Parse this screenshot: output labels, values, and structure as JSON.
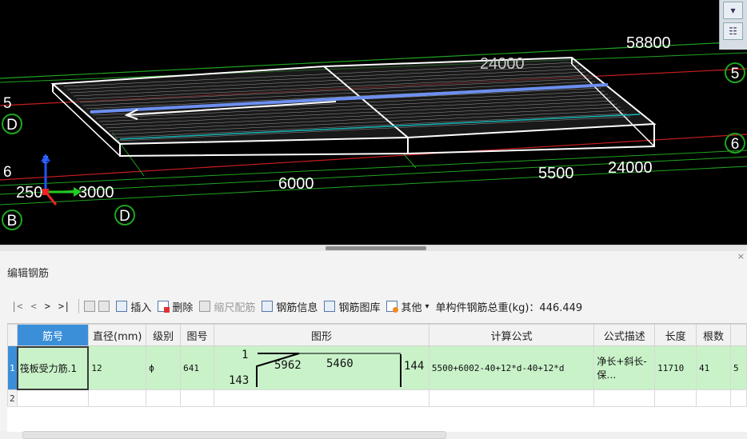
{
  "viewport": {
    "dim_labels": {
      "top_58800": "58800",
      "top_24000": "24000",
      "bottom_6000": "6000",
      "bottom_5500": "5500",
      "bottom_24000": "24000",
      "left_2500": "250",
      "left_3000": "3000"
    },
    "axis_labels": {
      "left_5": "5",
      "left_D": "D",
      "left_6": "6",
      "bottom_B": "B",
      "bottom_D": "D",
      "right_5": "5",
      "right_6": "6"
    },
    "gizmo_z": "Z",
    "colors": {
      "background": "#000000",
      "grid_green": "#1fa51f",
      "grid_red": "#c81e1e",
      "slab": "#ffffff",
      "rebar_blue": "#6d8ff0"
    }
  },
  "panel": {
    "title": "编辑钢筋",
    "close": "×",
    "toolbar": {
      "nav_first": "|<",
      "nav_prev": "<",
      "nav_next": ">",
      "nav_last": ">|",
      "insert": "插入",
      "delete": "删除",
      "scale": "缩尺配筋",
      "info": "钢筋信息",
      "library": "钢筋图库",
      "other": "其他",
      "other_arrow": "▾",
      "total_weight": "单构件钢筋总重(kg)：446.449"
    },
    "columns": [
      "筋号",
      "直径(mm)",
      "级别",
      "图号",
      "图形",
      "计算公式",
      "公式描述",
      "长度",
      "根数",
      ""
    ],
    "rows": [
      {
        "num": "1",
        "name": "筏板受力筋.1",
        "diameter": "12",
        "grade": "ф",
        "figure_no": "641",
        "shape": {
          "top_left": "1",
          "hook_left": "143",
          "mid_a": "5962",
          "mid_b": "5460",
          "right": "144"
        },
        "formula": "5500+6002-40+12*d-40+12*d",
        "description": "净长+斜长-保…",
        "length": "11710",
        "count": "41",
        "extra": "5"
      },
      {
        "num": "2",
        "name": "",
        "diameter": "",
        "grade": "",
        "figure_no": "",
        "formula": "",
        "description": "",
        "length": "",
        "count": "",
        "extra": ""
      }
    ]
  }
}
